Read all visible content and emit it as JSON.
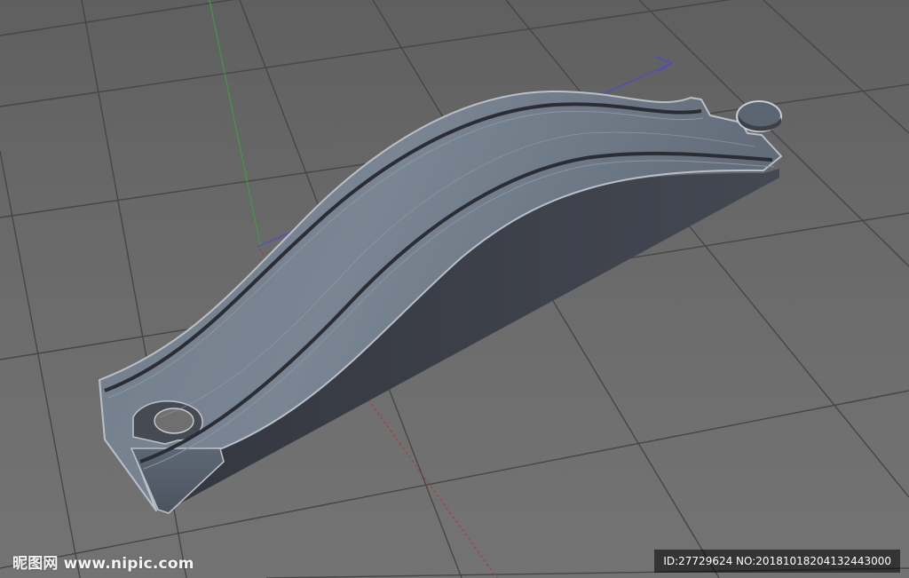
{
  "watermark": {
    "brand": "昵图网",
    "site": "www.nipic.com",
    "id_text": "ID:27729624 NO:20181018204132443000"
  },
  "colors": {
    "background": "#6b6b6b",
    "grid_line": "#474747",
    "axis_x": "#b03a3a",
    "axis_y": "#3f9a3f",
    "axis_z": "#4a4ad0",
    "model_top": "#6a7684",
    "model_side": "#3a3d45",
    "model_outline": "#b9c0c8"
  }
}
